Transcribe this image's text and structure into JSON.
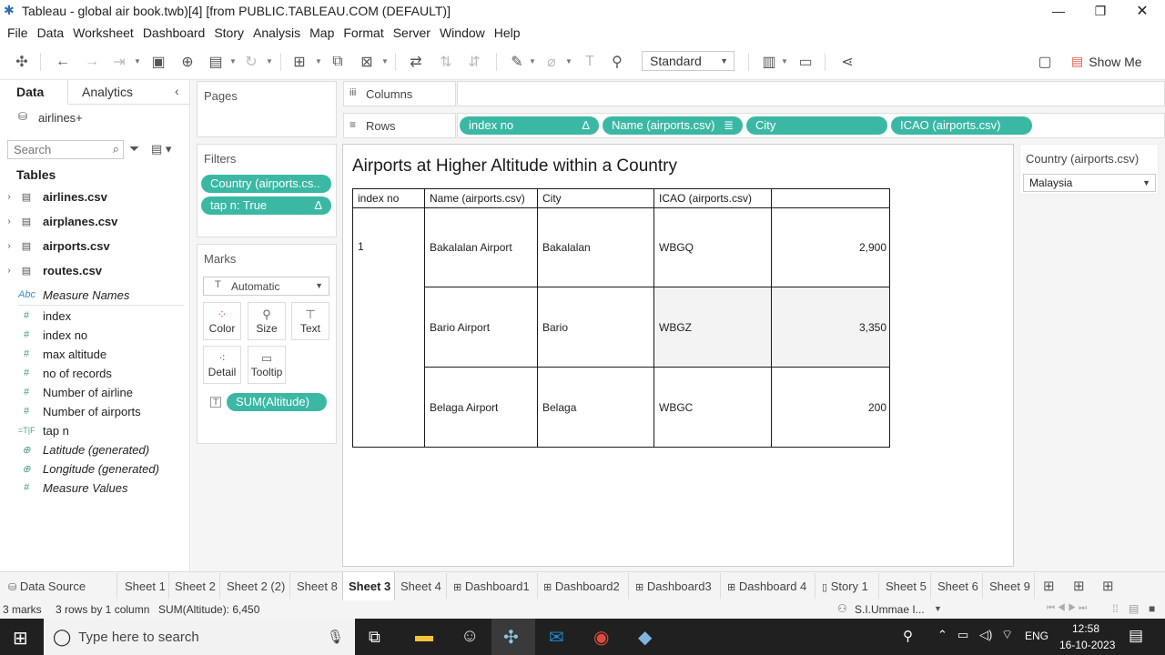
{
  "window": {
    "title": "Tableau - global air book.twb)[4] [from PUBLIC.TABLEAU.COM (DEFAULT)]"
  },
  "menu": [
    "File",
    "Data",
    "Worksheet",
    "Dashboard",
    "Story",
    "Analysis",
    "Map",
    "Format",
    "Server",
    "Window",
    "Help"
  ],
  "toolbar": {
    "fit_select": "Standard",
    "show_me": "Show Me"
  },
  "left_pane": {
    "tab_data": "Data",
    "tab_analytics": "Analytics",
    "datasource": "airlines+",
    "search_placeholder": "Search",
    "tables_heading": "Tables",
    "tables": [
      "airlines.csv",
      "airplanes.csv",
      "airports.csv",
      "routes.csv"
    ],
    "fields": [
      {
        "label": "Measure Names",
        "icon": "Abc",
        "italic": true
      },
      {
        "label": "index",
        "icon": "#"
      },
      {
        "label": "index no",
        "icon": "#"
      },
      {
        "label": "max altitude",
        "icon": "#"
      },
      {
        "label": "no of records",
        "icon": "#"
      },
      {
        "label": "Number of airline",
        "icon": "#"
      },
      {
        "label": "Number of airports",
        "icon": "#"
      },
      {
        "label": "tap n",
        "icon": "T|F"
      },
      {
        "label": "Latitude (generated)",
        "icon": "globe",
        "italic": true
      },
      {
        "label": "Longitude (generated)",
        "icon": "globe",
        "italic": true
      },
      {
        "label": "Measure Values",
        "icon": "#",
        "italic": true
      }
    ]
  },
  "cards": {
    "pages_title": "Pages",
    "filters_title": "Filters",
    "filters": [
      "Country (airports.cs..",
      "tap n: True"
    ],
    "filter_delta": "Δ",
    "marks_title": "Marks",
    "mark_type": "Automatic",
    "mark_buttons": [
      "Color",
      "Size",
      "Text",
      "Detail",
      "Tooltip"
    ],
    "mark_pill": "SUM(Altitude)"
  },
  "shelves": {
    "columns_label": "Columns",
    "rows_label": "Rows",
    "rows": [
      "index no",
      "Name (airports.csv)",
      "City",
      "ICAO (airports.csv)"
    ],
    "rows_delta": "Δ"
  },
  "viz": {
    "title": "Airports at Higher  Altitude within a Country",
    "headers": [
      "index no",
      "Name (airports.csv)",
      "City",
      "ICAO (airports.csv)",
      ""
    ],
    "index_value": "1",
    "rows": [
      {
        "name": "Bakalalan Airport",
        "city": "Bakalalan",
        "icao": "WBGQ",
        "value": "2,900"
      },
      {
        "name": "Bario Airport",
        "city": "Bario",
        "icao": "WBGZ",
        "value": "3,350"
      },
      {
        "name": "Belaga Airport",
        "city": "Belaga",
        "icao": "WBGC",
        "value": "200"
      }
    ]
  },
  "quick_filter": {
    "title": "Country (airports.csv)",
    "value": "Malaysia"
  },
  "sheet_tabs": [
    "Data Source",
    "Sheet 1",
    "Sheet 2",
    "Sheet 2 (2)",
    "Sheet 8",
    "Sheet 3",
    "Sheet 4",
    "Dashboard1",
    "Dashboard2",
    "Dashboard3",
    "Dashboard 4",
    "Story 1",
    "Sheet 5",
    "Sheet 6",
    "Sheet 9"
  ],
  "active_sheet": "Sheet 3",
  "status": {
    "marks": "3 marks",
    "rows_cols": "3 rows by 1 column",
    "sum": "SUM(Altitude): 6,450",
    "user": "S.I.Ummae I..."
  },
  "taskbar": {
    "search_placeholder": "Type here to search",
    "lang": "ENG",
    "time": "12:58",
    "date": "16-10-2023"
  }
}
